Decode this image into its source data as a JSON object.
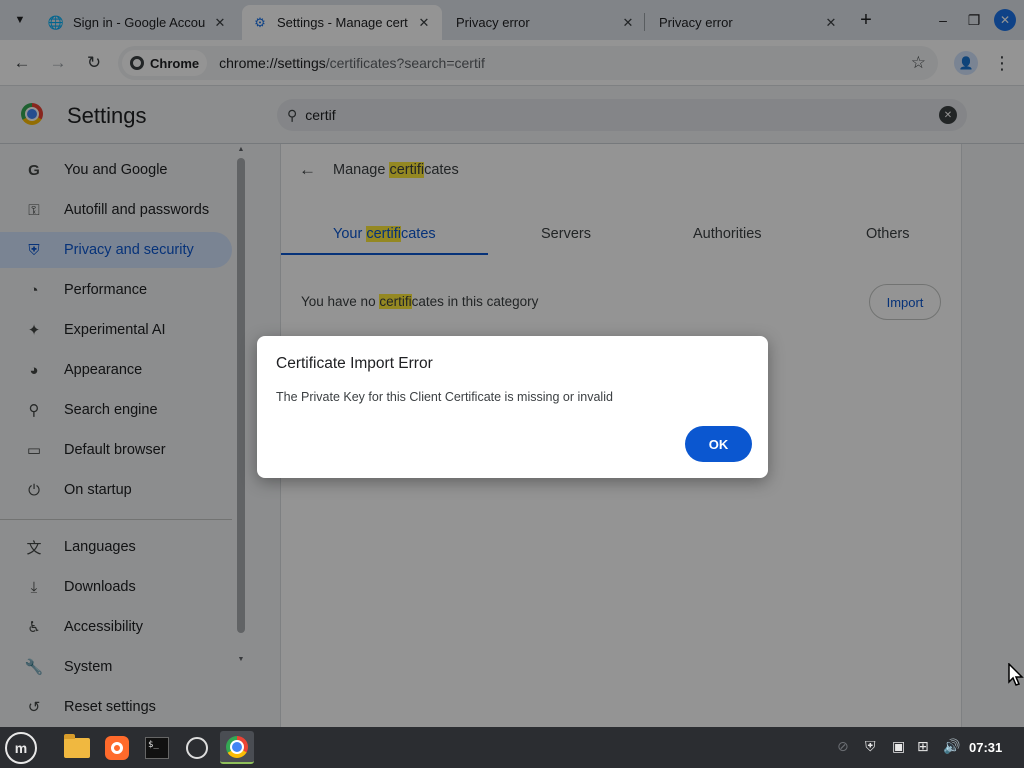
{
  "browser": {
    "tabs": [
      {
        "title": "Sign in - Google Accou",
        "favicon": "google-icon",
        "active": false
      },
      {
        "title": "Settings - Manage cert",
        "favicon": "gear-icon",
        "active": true
      },
      {
        "title": "Privacy error",
        "favicon": "",
        "active": false
      },
      {
        "title": "Privacy error",
        "favicon": "",
        "active": false
      }
    ],
    "new_tab_label": "+",
    "omnibox": {
      "chip_label": "Chrome",
      "url_host": "chrome://settings",
      "url_path": "/certificates?search=certif"
    }
  },
  "settings": {
    "title": "Settings",
    "search_value": "certif",
    "sidebar": {
      "items": [
        {
          "label": "You and Google",
          "icon": "google-g-icon",
          "glyph": "G"
        },
        {
          "label": "Autofill and passwords",
          "icon": "key-icon",
          "glyph": "⚿"
        },
        {
          "label": "Privacy and security",
          "icon": "shield-icon",
          "glyph": "⛨",
          "selected": true
        },
        {
          "label": "Performance",
          "icon": "speedometer-icon",
          "glyph": "◔"
        },
        {
          "label": "Experimental AI",
          "icon": "sparkle-icon",
          "glyph": "✦"
        },
        {
          "label": "Appearance",
          "icon": "palette-icon",
          "glyph": "◕"
        },
        {
          "label": "Search engine",
          "icon": "search-icon",
          "glyph": "⚲"
        },
        {
          "label": "Default browser",
          "icon": "browser-window-icon",
          "glyph": "▭"
        },
        {
          "label": "On startup",
          "icon": "power-icon",
          "glyph": "⏻"
        },
        {
          "label": "Languages",
          "icon": "translate-icon",
          "glyph": "文"
        },
        {
          "label": "Downloads",
          "icon": "download-icon",
          "glyph": "⤓"
        },
        {
          "label": "Accessibility",
          "icon": "accessibility-icon",
          "glyph": "♿"
        },
        {
          "label": "System",
          "icon": "wrench-icon",
          "glyph": "🔧"
        },
        {
          "label": "Reset settings",
          "icon": "reset-icon",
          "glyph": "↺"
        }
      ]
    },
    "certificates": {
      "title_before": "Manage ",
      "title_highlight": "certifi",
      "title_after": "cates",
      "tabs": {
        "yours_before": "Your ",
        "yours_highlight": "certifi",
        "yours_after": "cates",
        "servers": "Servers",
        "authorities": "Authorities",
        "others": "Others"
      },
      "empty_before": "You have no ",
      "empty_highlight": "certifi",
      "empty_after": "cates in this category",
      "import_label": "Import"
    }
  },
  "dialog": {
    "title": "Certificate Import Error",
    "message": "The Private Key for this Client Certificate is missing or invalid",
    "ok_label": "OK"
  },
  "taskbar": {
    "clock": "07:31"
  },
  "colors": {
    "accent": "#0b57d0",
    "highlight": "#ffeb3b",
    "taskbar": "#2b2d31"
  }
}
